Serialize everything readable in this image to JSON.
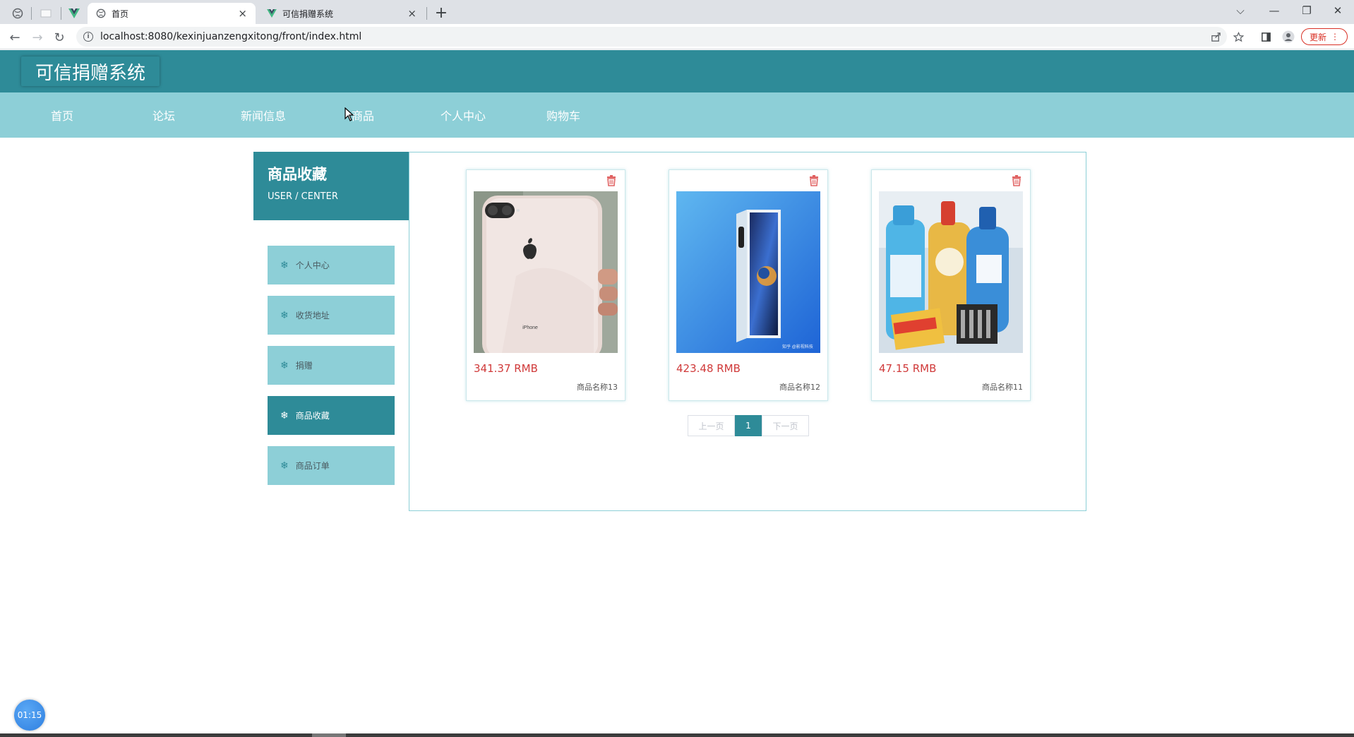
{
  "browser": {
    "tabs": [
      {
        "title": "首页",
        "close": "×"
      },
      {
        "title": "可信捐赠系统",
        "close": "×"
      }
    ],
    "new_tab": "+",
    "url": "localhost:8080/kexinjuanzengxitong/front/index.html",
    "update_label": "更新",
    "update_menu": "⋮",
    "window_controls": {
      "dropdown": "⌵",
      "minimize": "—",
      "restore": "❐",
      "close": "✕"
    },
    "nav": {
      "back": "←",
      "forward": "→",
      "reload": "↻"
    },
    "info": "i"
  },
  "site": {
    "title": "可信捐赠系统",
    "nav": [
      "首页",
      "论坛",
      "新闻信息",
      "商品",
      "个人中心",
      "购物车"
    ]
  },
  "sidebar": {
    "title": "商品收藏",
    "subtitle": "USER / CENTER",
    "items": [
      {
        "label": "个人中心",
        "active": false
      },
      {
        "label": "收货地址",
        "active": false
      },
      {
        "label": "捐赠",
        "active": false
      },
      {
        "label": "商品收藏",
        "active": true
      },
      {
        "label": "商品订单",
        "active": false
      }
    ],
    "item_icon": "❄"
  },
  "favorites": [
    {
      "price": "341.37 RMB",
      "name": "商品名称13",
      "image": "white-iphone-photo"
    },
    {
      "price": "423.48 RMB",
      "name": "商品名称12",
      "image": "foldable-phone-blue-photo"
    },
    {
      "price": "47.15 RMB",
      "name": "商品名称11",
      "image": "detergent-bottles-photo"
    }
  ],
  "iphone_text": "iPhone",
  "watermark": "知乎 @影视科技",
  "pagination": {
    "prev": "上一页",
    "current": "1",
    "next": "下一页"
  },
  "timer": "01:15",
  "colors": {
    "primary": "#2e8b98",
    "light": "#8dcfd7",
    "price": "#d03a3a"
  }
}
